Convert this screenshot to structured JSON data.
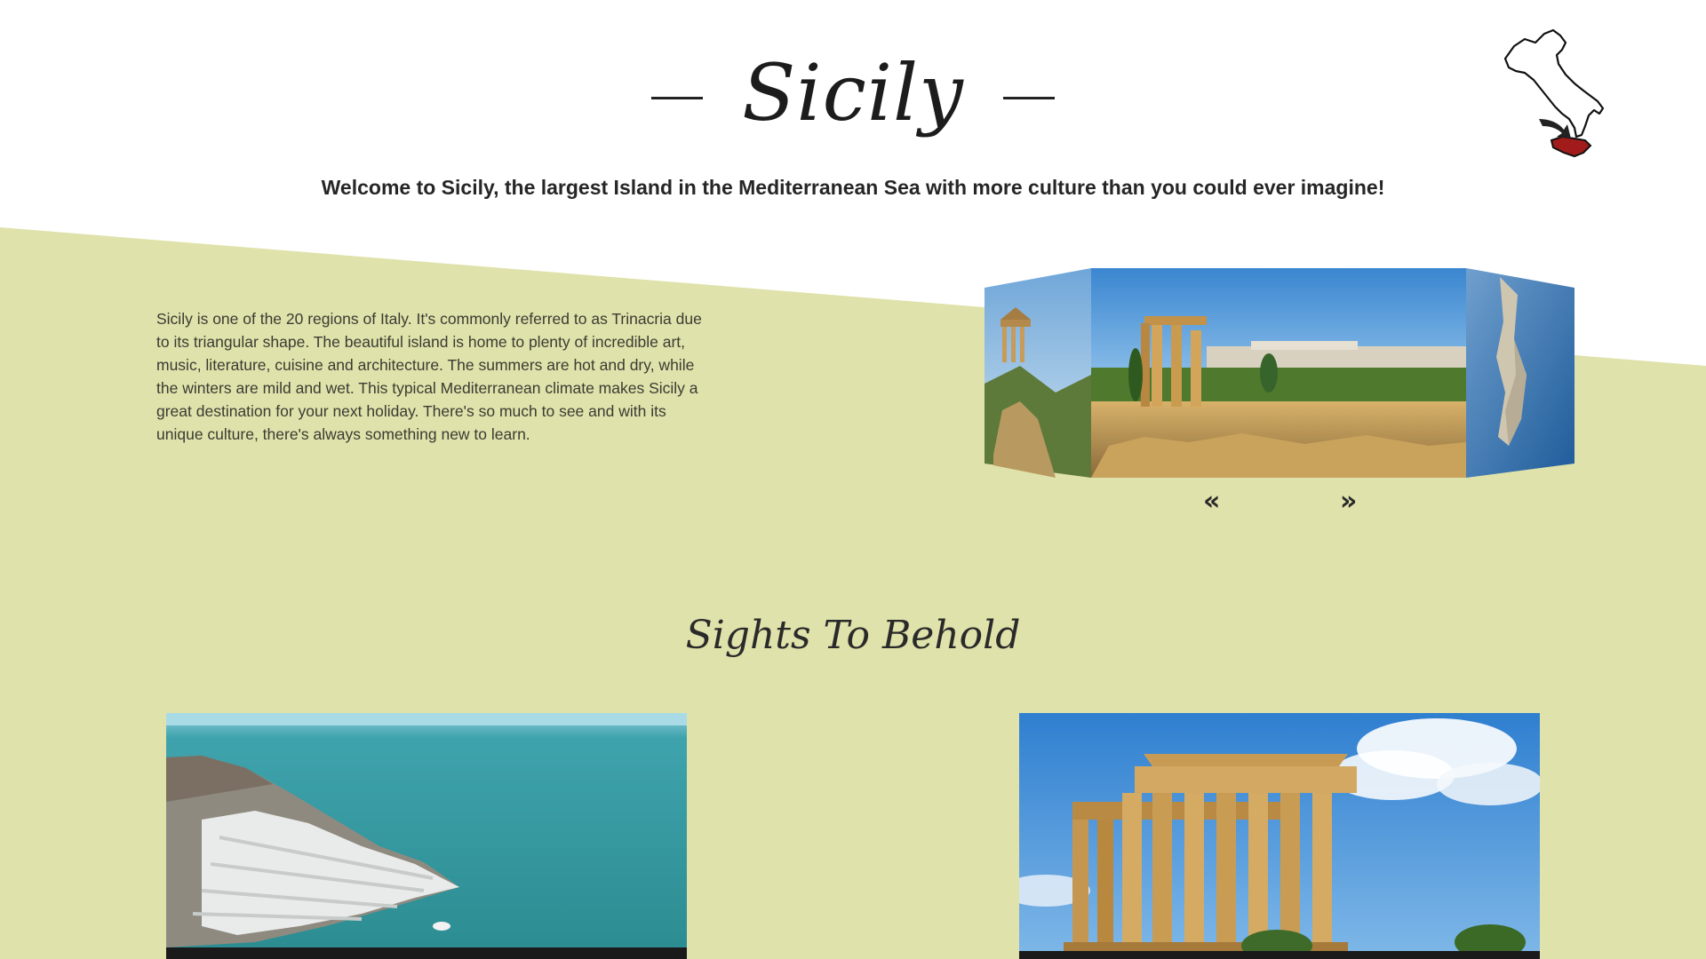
{
  "header": {
    "title": "Sicily",
    "intro": "Welcome to Sicily, the largest Island in the Mediterranean Sea with more culture than you could ever imagine!"
  },
  "about": {
    "description": "Sicily is one of the 20 regions of Italy. It's commonly referred to as Trinacria due to its triangular shape. The beautiful island is home to plenty of incredible art, music, literature, cuisine and architecture. The summers are hot and dry, while the winters are mild and wet. This typical Mediterranean climate makes Sicily a great destination for your next holiday. There's so much to see and with its unique culture, there's always something new to learn."
  },
  "carousel": {
    "prev_label": "«",
    "next_label": "»",
    "slides": [
      "temple-cliff-photo",
      "greek-temple-ruins-photo",
      "coastal-town-aerial-photo"
    ]
  },
  "sights": {
    "title": "Sights To Behold",
    "cards": [
      "white-cliff-coast-photo",
      "greek-temple-photo"
    ]
  },
  "colors": {
    "band": "#dfe2aa",
    "background": "#ffffff",
    "text": "#2a2a2a",
    "sicily_highlight": "#a11b1b"
  },
  "icons": {
    "map": "italy-map-icon",
    "arrow": "pointer-arrow-icon"
  }
}
